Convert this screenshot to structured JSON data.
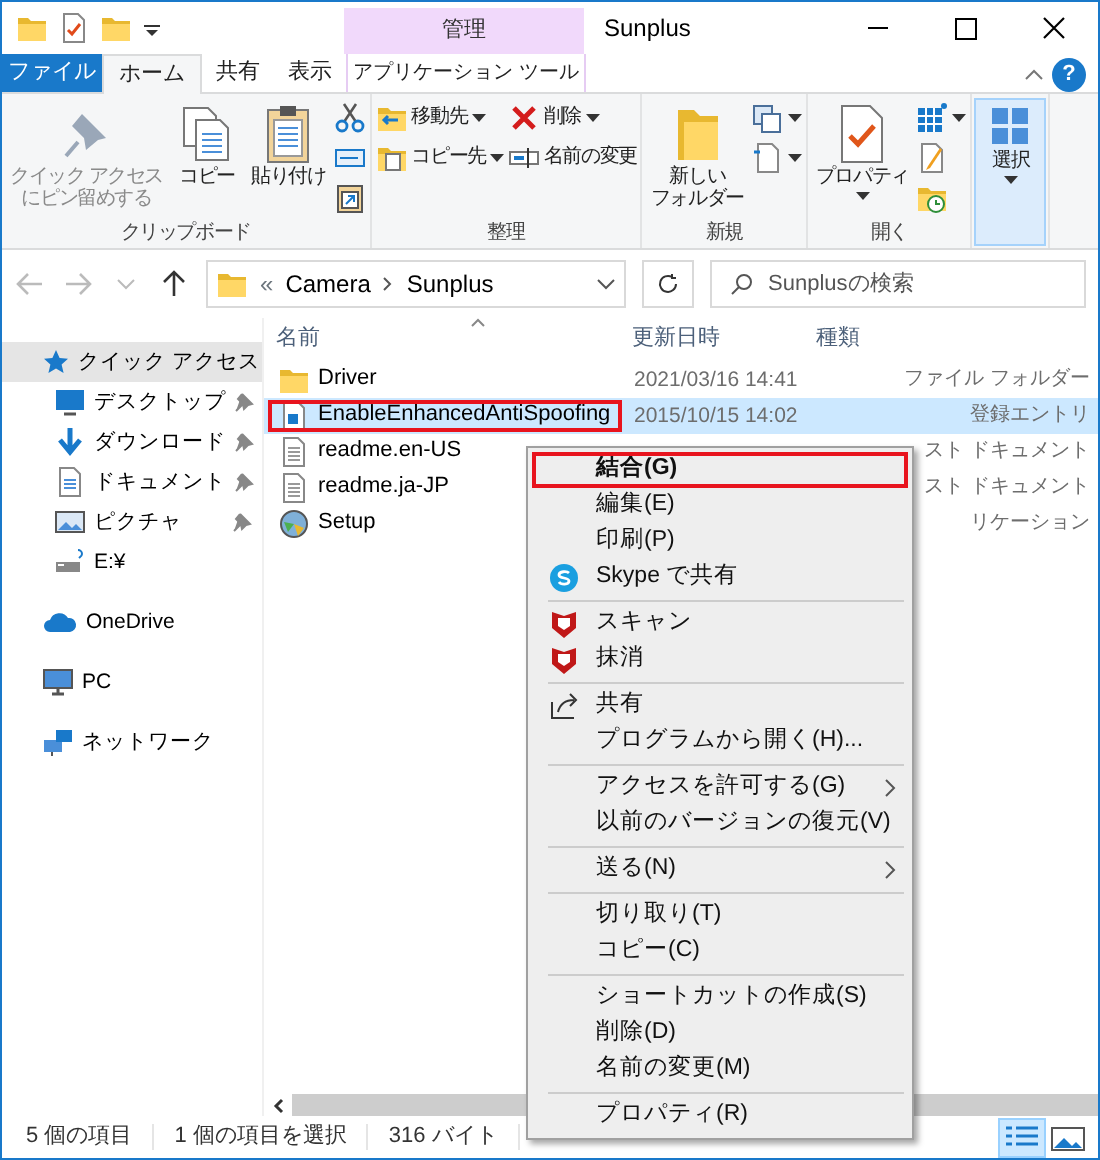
{
  "title_bar": {
    "context_group": "管理",
    "title": "Sunplus"
  },
  "ribbon_tabs": [
    {
      "label": "ファイル",
      "kind": "file",
      "selected": false
    },
    {
      "label": "ホーム",
      "kind": "tab",
      "selected": true
    },
    {
      "label": "共有",
      "kind": "tab",
      "selected": false
    },
    {
      "label": "表示",
      "kind": "tab",
      "selected": false
    },
    {
      "label": "アプリケーション ツール",
      "kind": "context",
      "selected": false
    }
  ],
  "help_button": "?",
  "ribbon_groups": [
    {
      "label": "クリップボード",
      "items": [
        {
          "kind": "large",
          "lines": [
            "クイック アクセス",
            "にピン留めする"
          ],
          "disabled": true,
          "dropdown": false,
          "highlighted": false
        },
        {
          "kind": "large",
          "lines": [
            "コピー"
          ],
          "disabled": false,
          "dropdown": false,
          "highlighted": false
        },
        {
          "kind": "large",
          "lines": [
            "貼り付け"
          ],
          "disabled": false,
          "dropdown": false,
          "highlighted": false
        },
        {
          "kind": "stack",
          "items": [
            {
              "dropdown": false
            },
            {
              "dropdown": false
            },
            {
              "dropdown": false
            }
          ]
        }
      ]
    },
    {
      "label": "整理",
      "items": [
        {
          "kind": "stack",
          "items": [
            {
              "label": "移動先",
              "dropdown": true
            },
            {
              "label": "コピー先",
              "dropdown": true
            }
          ]
        },
        {
          "kind": "stack",
          "items": [
            {
              "label": "削除",
              "dropdown": true
            },
            {
              "label": "名前の変更",
              "dropdown": false
            }
          ]
        }
      ]
    },
    {
      "label": "新規",
      "items": [
        {
          "kind": "large",
          "lines": [
            "新しい",
            "フォルダー"
          ],
          "disabled": false,
          "dropdown": false,
          "highlighted": false
        },
        {
          "kind": "stack",
          "items": [
            {
              "dropdown": true
            },
            {
              "dropdown": true
            }
          ]
        }
      ]
    },
    {
      "label": "開く",
      "items": [
        {
          "kind": "large",
          "lines": [
            "プロパティ"
          ],
          "disabled": false,
          "dropdown": true,
          "highlighted": false
        },
        {
          "kind": "stack",
          "items": [
            {
              "dropdown": true
            },
            {
              "dropdown": false
            },
            {
              "dropdown": false
            }
          ]
        }
      ]
    },
    {
      "items": [
        {
          "kind": "large",
          "lines": [
            "選択"
          ],
          "disabled": false,
          "dropdown": true,
          "highlighted": true
        }
      ]
    }
  ],
  "address_bar": {
    "overflow": "«",
    "crumbs": [
      "Camera",
      "Sunplus"
    ]
  },
  "search": {
    "placeholder": "Sunplusの検索"
  },
  "navigation": [
    {
      "label": "クイック アクセス",
      "selected": true,
      "pinned": false,
      "children": [
        {
          "label": "デスクトップ",
          "selected": false,
          "pinned": true
        },
        {
          "label": "ダウンロード",
          "selected": false,
          "pinned": true
        },
        {
          "label": "ドキュメント",
          "selected": false,
          "pinned": true
        },
        {
          "label": "ピクチャ",
          "selected": false,
          "pinned": true
        },
        {
          "label": "E:¥",
          "selected": false,
          "pinned": false
        }
      ]
    },
    {
      "label": "OneDrive",
      "selected": false,
      "pinned": false
    },
    {
      "label": "PC",
      "selected": false,
      "pinned": false
    },
    {
      "label": "ネットワーク",
      "selected": false,
      "pinned": false
    }
  ],
  "file_list": {
    "columns": [
      "名前",
      "更新日時",
      "種類"
    ],
    "rows": [
      {
        "name": "Driver",
        "kind": "folder",
        "date": "2021/03/16 14:41",
        "type": "ファイル フォルダー",
        "selected": false,
        "highlighted": false
      },
      {
        "name": "EnableEnhancedAntiSpoofing",
        "kind": "registry",
        "date": "2015/10/15 14:02",
        "type": "登録エントリ",
        "selected": true,
        "highlighted": true
      },
      {
        "name": "readme.en-US",
        "kind": "text",
        "type": "スト ドキュメント",
        "selected": false,
        "highlighted": false
      },
      {
        "name": "readme.ja-JP",
        "kind": "text",
        "type": "スト ドキュメント",
        "selected": false,
        "highlighted": false
      },
      {
        "name": "Setup",
        "kind": "application",
        "type": "リケーション",
        "selected": false,
        "highlighted": false
      }
    ]
  },
  "context_menu": [
    {
      "kind": "item",
      "label": "結合(G)",
      "default": true,
      "highlighted": true
    },
    {
      "kind": "item",
      "label": "編集(E)",
      "default": false,
      "highlighted": false
    },
    {
      "kind": "item",
      "label": "印刷(P)",
      "default": false,
      "highlighted": false
    },
    {
      "kind": "item",
      "label": "Skype で共有",
      "default": false,
      "highlighted": false
    },
    {
      "kind": "separator"
    },
    {
      "kind": "item",
      "label": "スキャン",
      "default": false,
      "highlighted": false
    },
    {
      "kind": "item",
      "label": "抹消",
      "default": false,
      "highlighted": false
    },
    {
      "kind": "separator"
    },
    {
      "kind": "item",
      "label": "共有",
      "default": false,
      "highlighted": false
    },
    {
      "kind": "item",
      "label": "プログラムから開く(H)...",
      "default": false,
      "highlighted": false
    },
    {
      "kind": "separator"
    },
    {
      "kind": "submenu",
      "label": "アクセスを許可する(G)",
      "default": false,
      "highlighted": false
    },
    {
      "kind": "item",
      "label": "以前のバージョンの復元(V)",
      "default": false,
      "highlighted": false
    },
    {
      "kind": "separator"
    },
    {
      "kind": "submenu",
      "label": "送る(N)",
      "default": false,
      "highlighted": false
    },
    {
      "kind": "separator"
    },
    {
      "kind": "item",
      "label": "切り取り(T)",
      "default": false,
      "highlighted": false
    },
    {
      "kind": "item",
      "label": "コピー(C)",
      "default": false,
      "highlighted": false
    },
    {
      "kind": "separator"
    },
    {
      "kind": "item",
      "label": "ショートカットの作成(S)",
      "default": false,
      "highlighted": false
    },
    {
      "kind": "item",
      "label": "削除(D)",
      "default": false,
      "highlighted": false
    },
    {
      "kind": "item",
      "label": "名前の変更(M)",
      "default": false,
      "highlighted": false
    },
    {
      "kind": "separator"
    },
    {
      "kind": "item",
      "label": "プロパティ(R)",
      "default": false,
      "highlighted": false
    }
  ],
  "status_bar": {
    "items": [
      "5 個の項目",
      "1 個の項目を選択",
      "316 バイト"
    ],
    "views": [
      {
        "selected": true
      },
      {
        "selected": false
      }
    ]
  }
}
